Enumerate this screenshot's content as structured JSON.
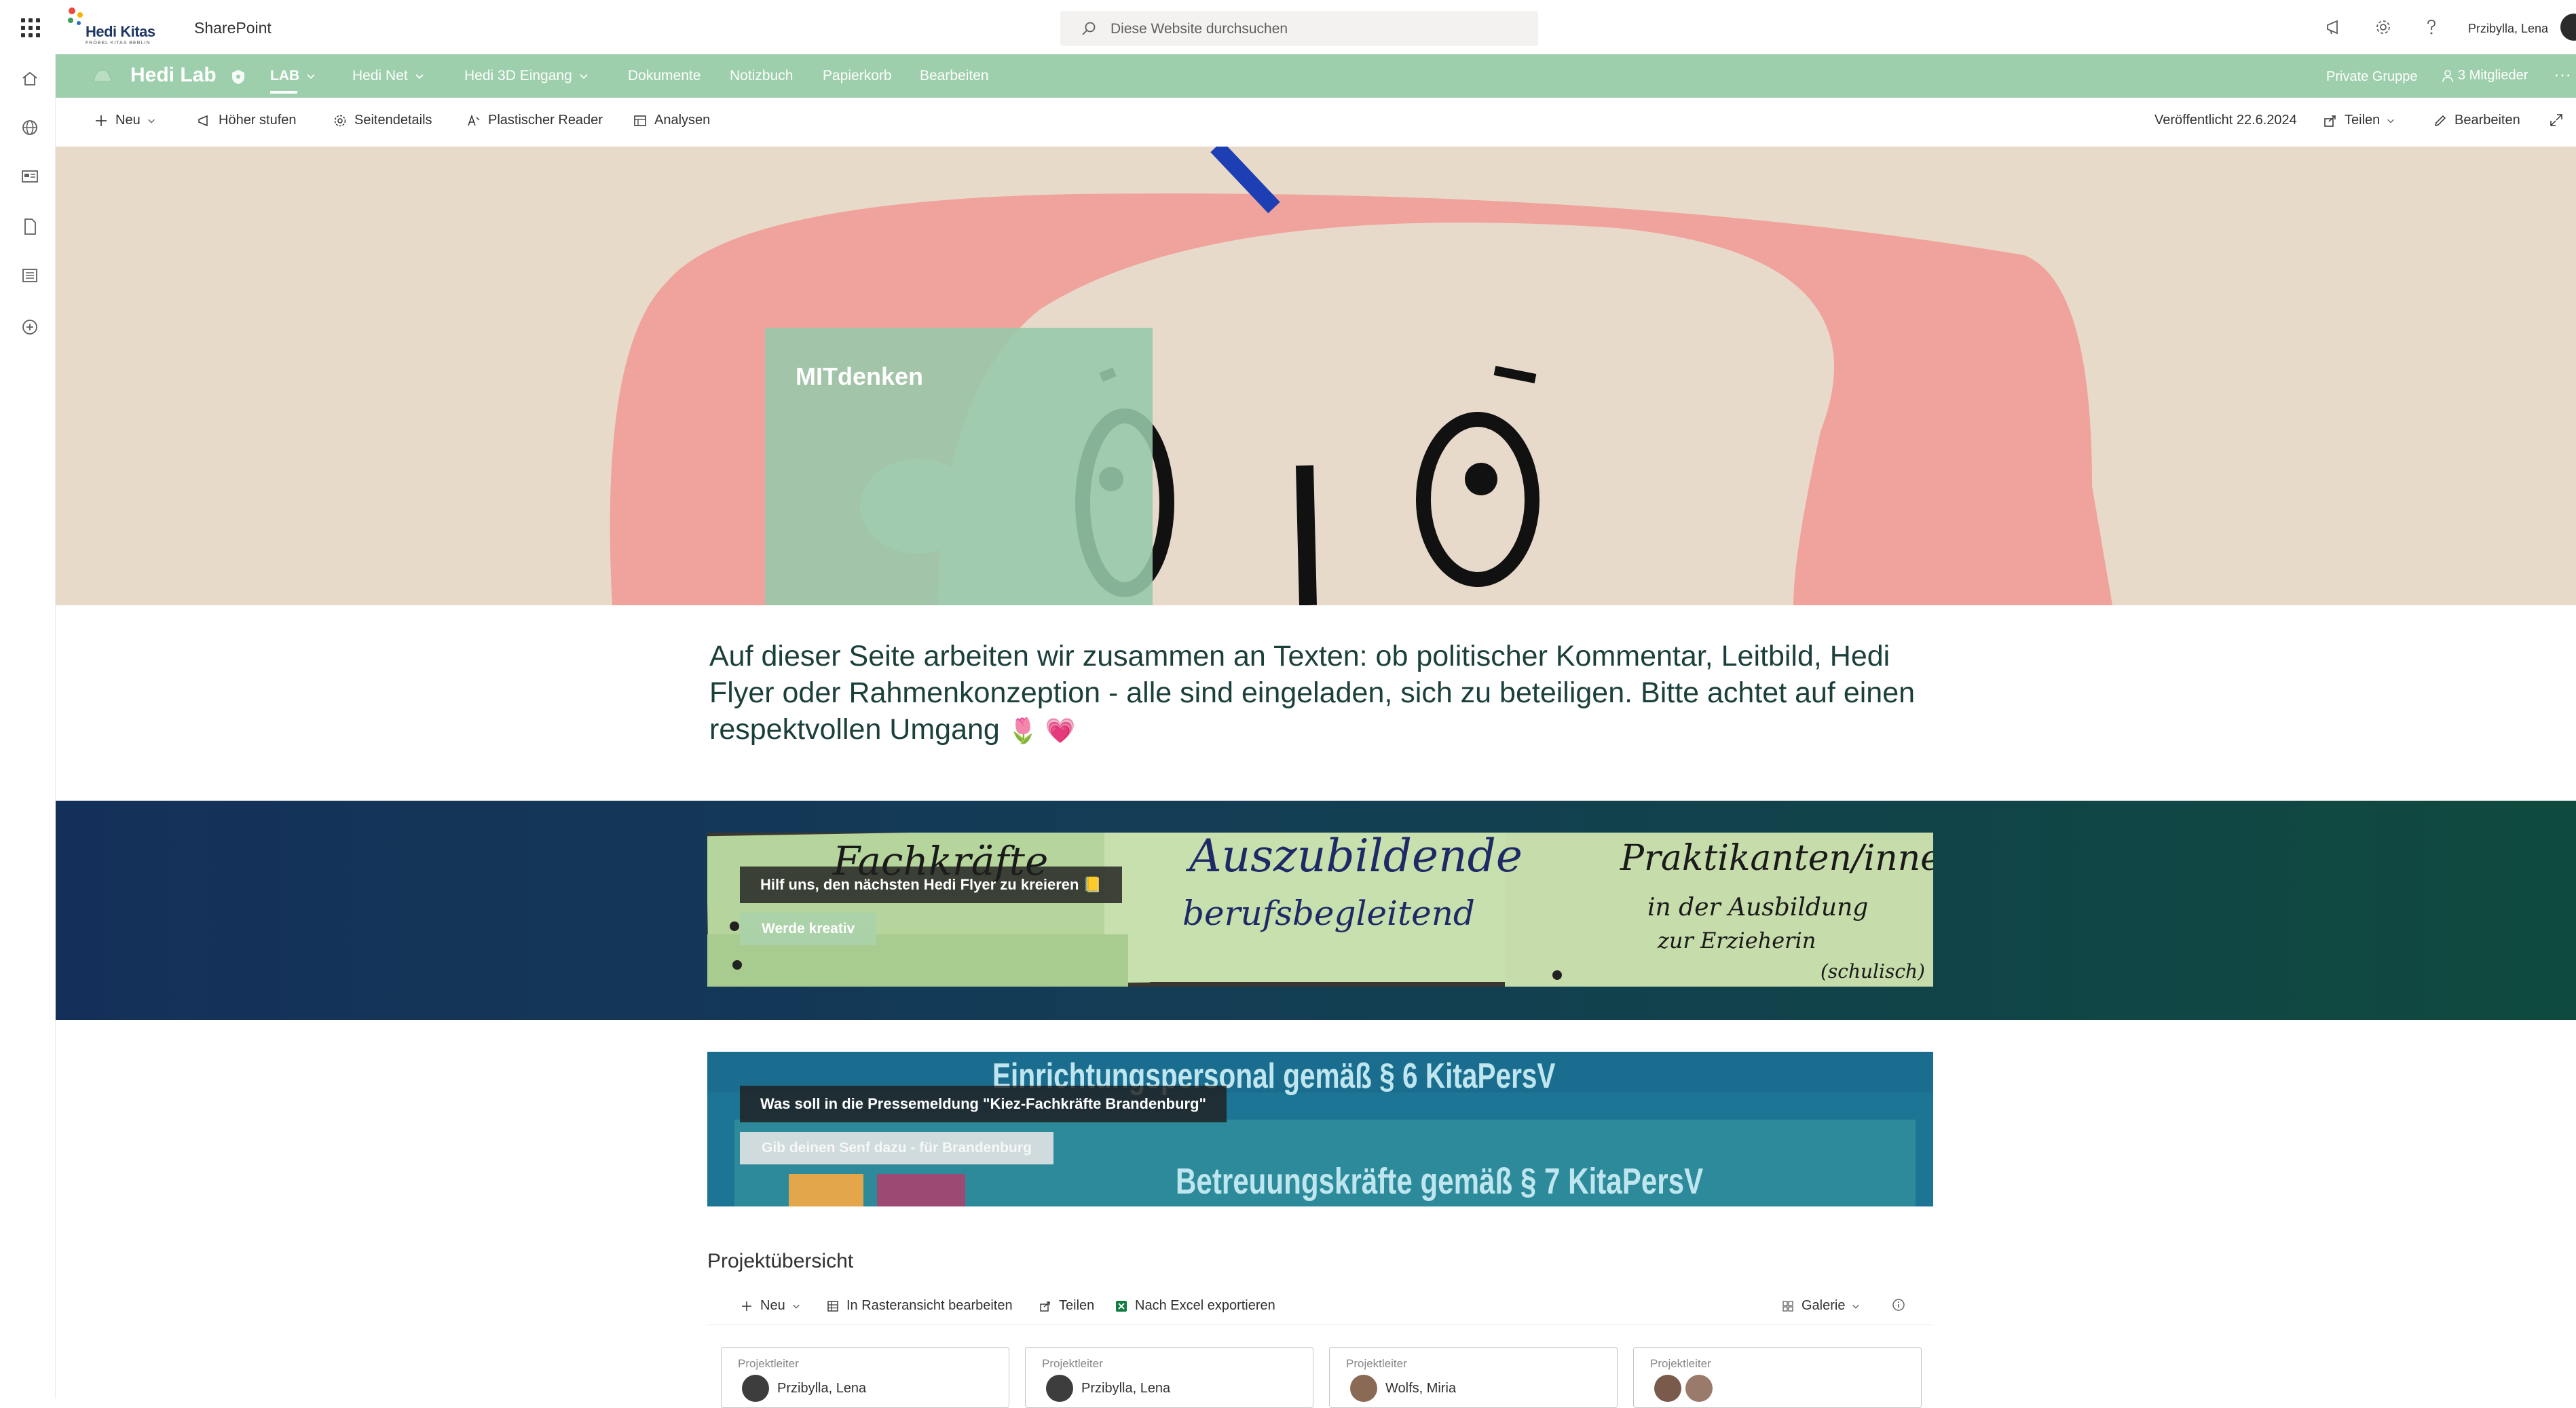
{
  "suitebar": {
    "logo_text": "Hedi Kitas",
    "logo_subtext": "FRÖBEL KITAS BERLIN",
    "app_name": "SharePoint",
    "search_placeholder": "Diese Website durchsuchen",
    "icons": [
      "megaphone-icon",
      "gear-icon",
      "help-icon"
    ],
    "user_name": "Przibylla, Lena"
  },
  "leftrail": {
    "icons": [
      "home-icon",
      "globe-icon",
      "news-icon",
      "document-icon",
      "list-icon",
      "add-icon"
    ]
  },
  "site": {
    "title": "Hedi Lab",
    "nav": [
      {
        "label": "LAB",
        "has_chevron": true,
        "active": true
      },
      {
        "label": "Hedi Net",
        "has_chevron": true
      },
      {
        "label": "Hedi 3D Eingang",
        "has_chevron": true
      },
      {
        "label": "Dokumente"
      },
      {
        "label": "Notizbuch"
      },
      {
        "label": "Papierkorb"
      },
      {
        "label": "Bearbeiten"
      }
    ],
    "private_group": "Private Gruppe",
    "members": "3 Mitglieder",
    "more": "···"
  },
  "commandbar": {
    "new": "Neu",
    "promote": "Höher stufen",
    "page_details": "Seitendetails",
    "immersive_reader": "Plastischer Reader",
    "analytics": "Analysen",
    "published": "Veröffentlicht 22.6.2024",
    "share": "Teilen",
    "edit": "Bearbeiten"
  },
  "hero": {
    "title": "MITdenken"
  },
  "intro": {
    "text": "Auf dieser Seite arbeiten wir zusammen an Texten: ob politischer Kommentar, Leitbild, Hedi Flyer oder Rahmenkonzeption - alle sind eingeladen, sich zu beteiligen. Bitte achtet auf einen respektvollen Umgang",
    "emoji": "🌷 💗"
  },
  "banner1": {
    "title": "Hilf uns, den nächsten Hedi Flyer zu kreieren 📒",
    "button": "Werde kreativ",
    "note1": "Fachkräfte",
    "note2_line1": "Auszubildende",
    "note2_line2": "berufsbegleitend",
    "note3_line1": "Praktikanten/innen",
    "note3_line2": "in der Ausbildung",
    "note3_line3": "zur Erzieherin",
    "note3_line4": "(schulisch)"
  },
  "banner2": {
    "title": "Was soll in die Pressemeldung \"Kiez-Fachkräfte Brandenburg\"",
    "button": "Gib deinen Senf dazu - für Brandenburg",
    "bg_line1": "Einrichtungspersonal gemäß § 6 KitaPersV",
    "bg_line2": "Betreuungskräfte gemäß § 7 KitaPersV"
  },
  "projects": {
    "title": "Projektübersicht",
    "new": "Neu",
    "grid_edit": "In Rasteransicht bearbeiten",
    "share": "Teilen",
    "export": "Nach Excel exportieren",
    "view": "Galerie",
    "cards": [
      {
        "label": "Projektleiter",
        "person": "Przibylla, Lena"
      },
      {
        "label": "Projektleiter",
        "person": "Przibylla, Lena"
      },
      {
        "label": "Projektleiter",
        "person": "Wolfs, Miria"
      },
      {
        "label": "Projektleiter",
        "person": ""
      }
    ]
  },
  "colors": {
    "site_header": "#9dcfac",
    "band_start": "#14305a",
    "band_end": "#0f4a3e",
    "intro_text": "#1b3f3a"
  }
}
